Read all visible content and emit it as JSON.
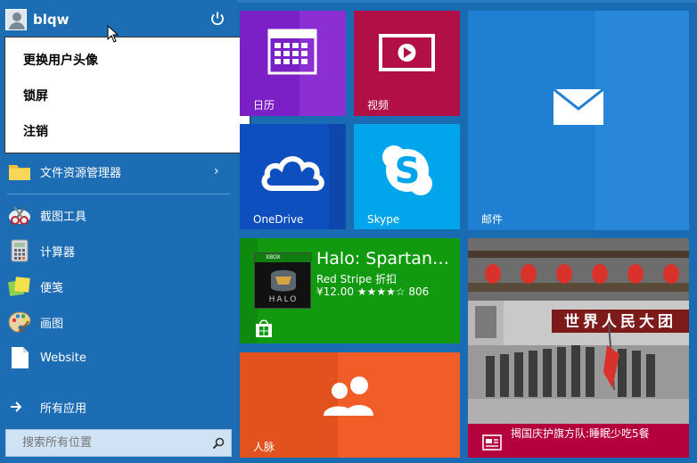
{
  "user": {
    "name": "blqw"
  },
  "user_menu": {
    "items": [
      "更换用户头像",
      "锁屏",
      "注销"
    ]
  },
  "apps": [
    {
      "label": "文件资源管理器",
      "icon": "folder-icon",
      "has_submenu": true
    },
    {
      "label": "截图工具",
      "icon": "scissors-icon"
    },
    {
      "label": "计算器",
      "icon": "calculator-icon"
    },
    {
      "label": "便笺",
      "icon": "sticky-notes-icon"
    },
    {
      "label": "画图",
      "icon": "palette-icon"
    },
    {
      "label": "Website",
      "icon": "document-icon"
    }
  ],
  "all_apps": {
    "label": "所有应用",
    "icon": "arrow-right-icon"
  },
  "search": {
    "placeholder": "搜索所有位置"
  },
  "tiles": {
    "calendar": {
      "label": "日历",
      "color": "#7b1fc7"
    },
    "video": {
      "label": "视频",
      "color": "#b10f45"
    },
    "mail": {
      "label": "邮件",
      "color": "#1f7fd2"
    },
    "onedrive": {
      "label": "OneDrive",
      "color": "#0e4fc0"
    },
    "skype": {
      "label": "Skype",
      "color": "#00a5ec"
    },
    "halo": {
      "title": "Halo: Spartan…",
      "subtitle": "Red Stripe 折扣",
      "price": "¥12.00 ★★★★☆ 806",
      "art_label": "HALO",
      "brand": "XBOX",
      "color": "#119a10"
    },
    "people": {
      "label": "人脉",
      "color": "#e2521f"
    },
    "news": {
      "headline": "揭国庆护旗方队:睡眠少吃5餐",
      "banner": "世界人民大团",
      "color": "#b4003c"
    }
  }
}
